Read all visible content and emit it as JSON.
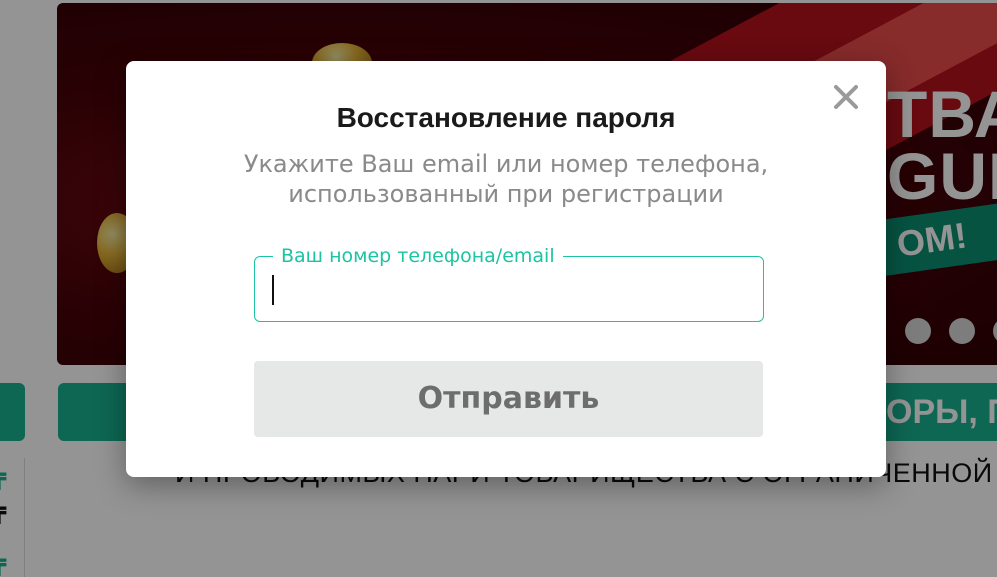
{
  "background": {
    "banner_text_line1": "ТВА",
    "banner_text_line2": "GUE:",
    "banner_pill_text": "OM!",
    "green_tab_text": "ОРЫ, П",
    "background_line": "И ПРОВОДИМЫХ ПАРИ ТОВАРИЩЕСТВА С ОГРАНИЧЕННОЙ ОТВЕТС",
    "side_currency_1": "₸",
    "side_currency_2": "₸",
    "side_currency_3": "₸",
    "colors": {
      "accent_green": "#17b28f",
      "banner_dark": "#4a0309",
      "banner_red": "#b3121c"
    }
  },
  "modal": {
    "title": "Восстановление пароля",
    "subtitle_line1": "Укажите Ваш email или номер телефона,",
    "subtitle_line2": "использованный при регистрации",
    "field_label": "Ваш номер телефона/email",
    "field_value": "",
    "submit_label": "Отправить",
    "close_icon": "close-icon",
    "colors": {
      "field_border": "#1cc4a1",
      "button_bg": "#e6e7e7",
      "button_text": "#6d6d6d"
    }
  }
}
